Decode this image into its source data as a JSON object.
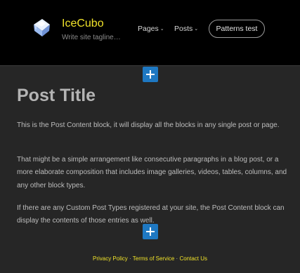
{
  "header": {
    "site_title": "IceCubo",
    "tagline": "Write site tagline…",
    "logo_icon": "ice-cube-icon",
    "nav": {
      "pages_label": "Pages",
      "posts_label": "Posts",
      "dropdown_icon": "chevron-down-icon",
      "patterns_button_label": "Patterns test"
    }
  },
  "editor": {
    "inserter_icon": "plus-icon"
  },
  "post": {
    "title": "Post Title",
    "paragraphs": [
      "This is the Post Content block, it will display all the blocks in any single post or page.",
      "That might be a simple arrangement like consecutive paragraphs in a blog post, or a more elaborate composition that includes image galleries, videos, tables, columns, and any other block types.",
      "If there are any Custom Post Types registered at your site, the Post Content block can display the contents of those entries as well."
    ]
  },
  "footer": {
    "links": [
      "Privacy Policy",
      "Terms of Service",
      "Contact Us"
    ],
    "separator": " · "
  },
  "colors": {
    "accent_yellow": "#f0e22a",
    "inserter_blue": "#1e78c2",
    "header_bg": "#000000",
    "page_bg": "#262626"
  }
}
